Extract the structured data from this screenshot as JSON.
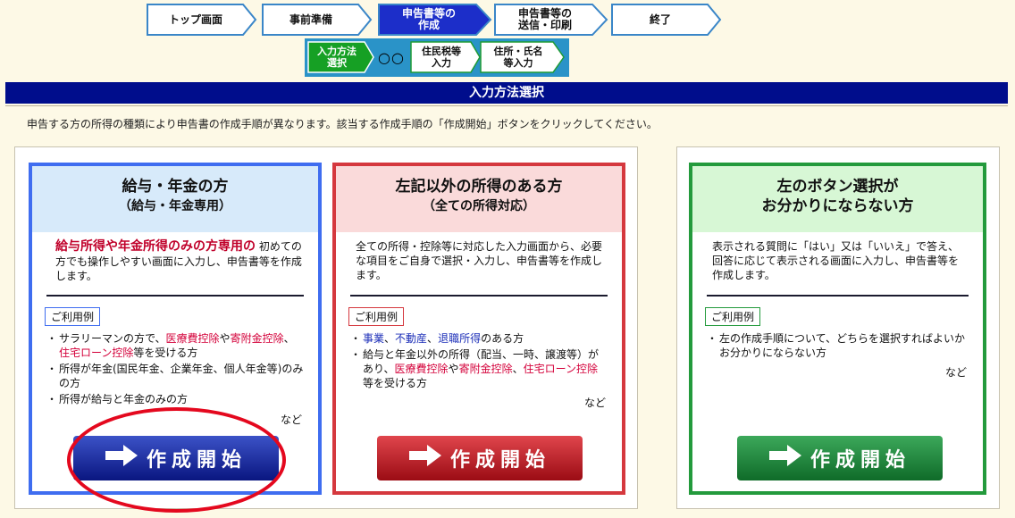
{
  "steps": [
    "トップ画面",
    "事前準備",
    "申告書等の\n作成",
    "申告書等の\n送信・印刷",
    "終了"
  ],
  "substeps": [
    "入力方法\n選択",
    "住民税等\n入力",
    "住所・氏名\n等入力"
  ],
  "substep_dots": "○○",
  "page_title": "入力方法選択",
  "instruction": "申告する方の所得の種類により申告書の作成手順が異なります。該当する作成手順の「作成開始」ボタンをクリックしてください。",
  "cards": {
    "salary": {
      "title": "給与・年金の方",
      "subtitle": "（給与・年金専用）",
      "desc_em": "給与所得や年金所得のみの方専用の",
      "desc": "初めての方でも操作しやすい画面に入力し、申告書等を作成します。",
      "example_label": "ご利用例",
      "ex1_a": "サラリーマンの方で、",
      "ex1_b": "医療費控除",
      "ex1_c": "や",
      "ex1_d": "寄附金控除",
      "ex1_e": "、",
      "ex1_f": "住宅ローン控除",
      "ex1_g": "等を受ける方",
      "ex2": "所得が年金(国民年金、企業年金、個人年金等)のみの方",
      "ex3": "所得が給与と年金のみの方",
      "etc": "など",
      "button": "作成開始"
    },
    "other": {
      "title": "左記以外の所得のある方",
      "subtitle": "（全ての所得対応）",
      "desc": "全ての所得・控除等に対応した入力画面から、必要な項目をご自身で選択・入力し、申告書等を作成します。",
      "example_label": "ご利用例",
      "ex1_a": "事業",
      "ex1_b": "、",
      "ex1_c": "不動産",
      "ex1_d": "、",
      "ex1_e": "退職所得",
      "ex1_f": "のある方",
      "ex2_a": "給与と年金以外の所得（配当、一時、譲渡等）があり、",
      "ex2_b": "医療費控除",
      "ex2_c": "や",
      "ex2_d": "寄附金控除",
      "ex2_e": "、",
      "ex2_f": "住宅ローン控除",
      "ex2_g": "等を受ける方",
      "etc": "など",
      "button": "作成開始"
    },
    "unsure": {
      "title": "左のボタン選択が",
      "subtitle": "お分かりにならない方",
      "desc": "表示される質問に「はい」又は「いいえ」で答え、回答に応じて表示される画面に入力し、申告書等を作成します。",
      "example_label": "ご利用例",
      "ex1": "左の作成手順について、どちらを選択すればよいかお分かりにならない方",
      "etc": "など",
      "button": "作成開始"
    }
  },
  "colors": {
    "navy": "#000d8c",
    "blue_card": "#3f6df0",
    "red_card": "#d5383e",
    "green_card": "#239a3c",
    "highlight": "#e4081e"
  }
}
